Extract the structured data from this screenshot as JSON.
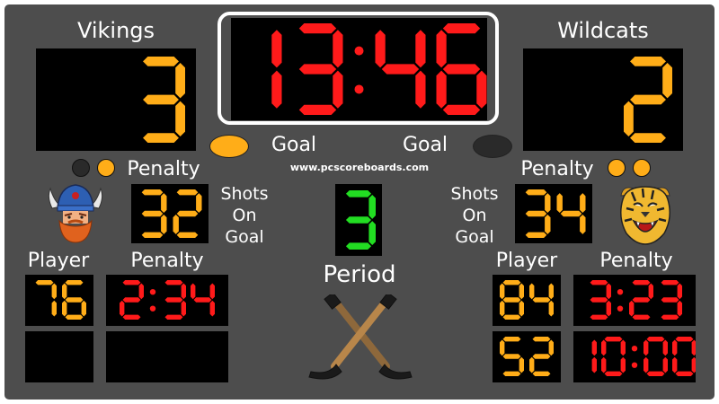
{
  "colors": {
    "panel": "#4d4d4d",
    "display_bg": "#000000",
    "clock_red": "#ff1a1a",
    "score_amber": "#ffad18",
    "period_green": "#22dd22",
    "label": "#ffffff"
  },
  "clock": {
    "minutes": "13",
    "seconds": "46"
  },
  "url": "www.pcscoreboards.com",
  "period": {
    "label": "Period",
    "value": "3"
  },
  "center_icon": "crossed-hockey-sticks-icon",
  "home": {
    "name": "Vikings",
    "score": "3",
    "goal_label": "Goal",
    "goal_light": "on",
    "penalty_label": "Penalty",
    "penalty_lights": [
      "off",
      "on"
    ],
    "logo": "viking-head-logo",
    "shots": "32",
    "shots_label": [
      "Shots",
      "On",
      "Goal"
    ],
    "player_header": "Player",
    "penalty_header": "Penalty",
    "penalties": [
      {
        "player": "76",
        "min": "2",
        "sec": "34"
      },
      {
        "player": "",
        "min": "",
        "sec": ""
      }
    ]
  },
  "away": {
    "name": "Wildcats",
    "score": "2",
    "goal_label": "Goal",
    "goal_light": "off",
    "penalty_label": "Penalty",
    "penalty_lights": [
      "on",
      "on"
    ],
    "logo": "wildcat-tiger-logo",
    "shots": "34",
    "shots_label": [
      "Shots",
      "On",
      "Goal"
    ],
    "player_header": "Player",
    "penalty_header": "Penalty",
    "penalties": [
      {
        "player": "84",
        "min": "3",
        "sec": "23"
      },
      {
        "player": "52",
        "min": "10",
        "sec": "00"
      }
    ]
  }
}
